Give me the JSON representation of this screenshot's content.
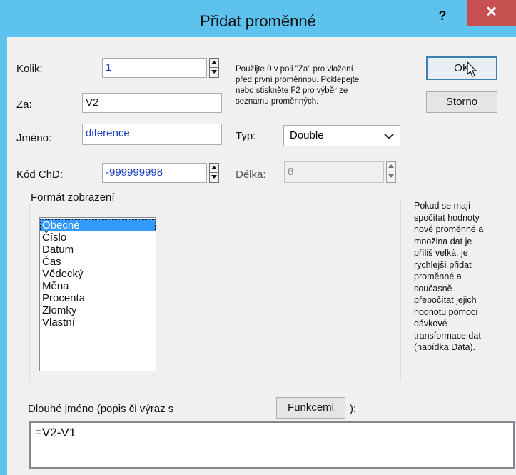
{
  "window": {
    "title": "Přidat proměnné",
    "help_glyph": "?",
    "close_glyph": "✕"
  },
  "fields": {
    "kolik": {
      "label": "Kolik:",
      "value": "1"
    },
    "za": {
      "label": "Za:",
      "value": "V2"
    },
    "jmeno": {
      "label": "Jméno:",
      "value": "diference"
    },
    "kod_chd": {
      "label": "Kód ChD:",
      "value": "-999999998"
    },
    "typ": {
      "label": "Typ:",
      "value": "Double"
    },
    "delka": {
      "label": "Délka:",
      "value": "8"
    }
  },
  "help_text": [
    "Použijte 0 v poli \"Za\" pro vložení",
    "před první proměnnou. Poklepejte",
    "nebo stiskněte F2 pro výběr ze",
    "seznamu proměnných."
  ],
  "buttons": {
    "ok": "OK",
    "cancel": "Storno",
    "functions": "Funkcemi"
  },
  "format_group": {
    "title": "Formát zobrazení",
    "options": [
      "Obecné",
      "Číslo",
      "Datum",
      "Čas",
      "Vědecký",
      "Měna",
      "Procenta",
      "Zlomky",
      "Vlastní"
    ],
    "selected": "Obecné"
  },
  "side_note": [
    "Pokud se mají",
    "spočítat hodnoty",
    "nové proměnné a",
    "množina dat je",
    "příliš velká, je",
    "rychlejší přidat",
    "proměnné a",
    "současně",
    "přepočítat jejich",
    "hodnotu pomocí",
    "dávkové",
    "transformace dat",
    "(nabídka Data)."
  ],
  "long_name": {
    "label": "Dlouhé jméno (popis či výraz s",
    "suffix": "):",
    "value": "=V2-V1"
  },
  "colors": {
    "titlebar": "#5ec2ef",
    "close_button": "#c75050",
    "selection": "#3399ff",
    "value_text": "#1a3cbf"
  }
}
